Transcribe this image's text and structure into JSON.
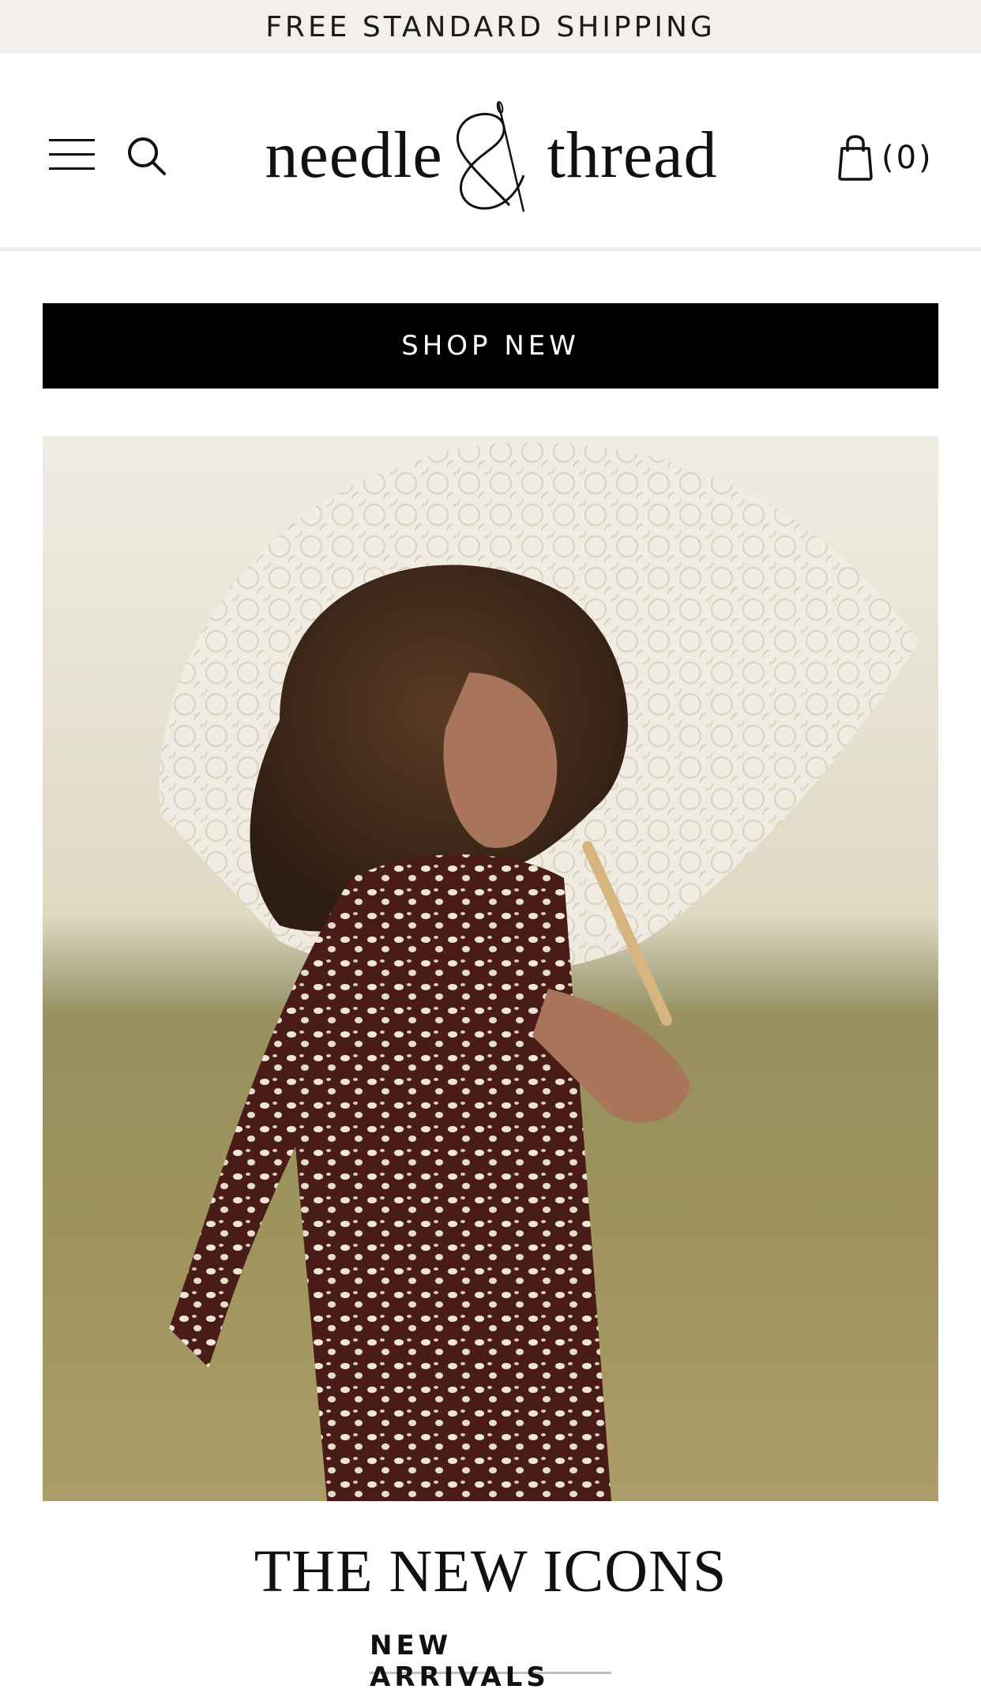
{
  "promo": {
    "text": "FREE STANDARD SHIPPING"
  },
  "header": {
    "logo_left": "needle",
    "logo_right": "thread",
    "cart_count": "(0)"
  },
  "shop_new": {
    "label": "SHOP NEW"
  },
  "hero": {
    "icon": "hero-photo",
    "colors": {
      "grass": "#8f8752",
      "sky": "#e8e4d6",
      "dress": "#4a1c18",
      "lace": "#f2ede4"
    }
  },
  "section": {
    "title": "THE NEW ICONS",
    "link_label": "NEW ARRIVALS"
  },
  "icons": [
    "hamburger-menu-icon",
    "search-icon",
    "shopping-bag-icon",
    "needle-thread-ampersand-logo"
  ]
}
